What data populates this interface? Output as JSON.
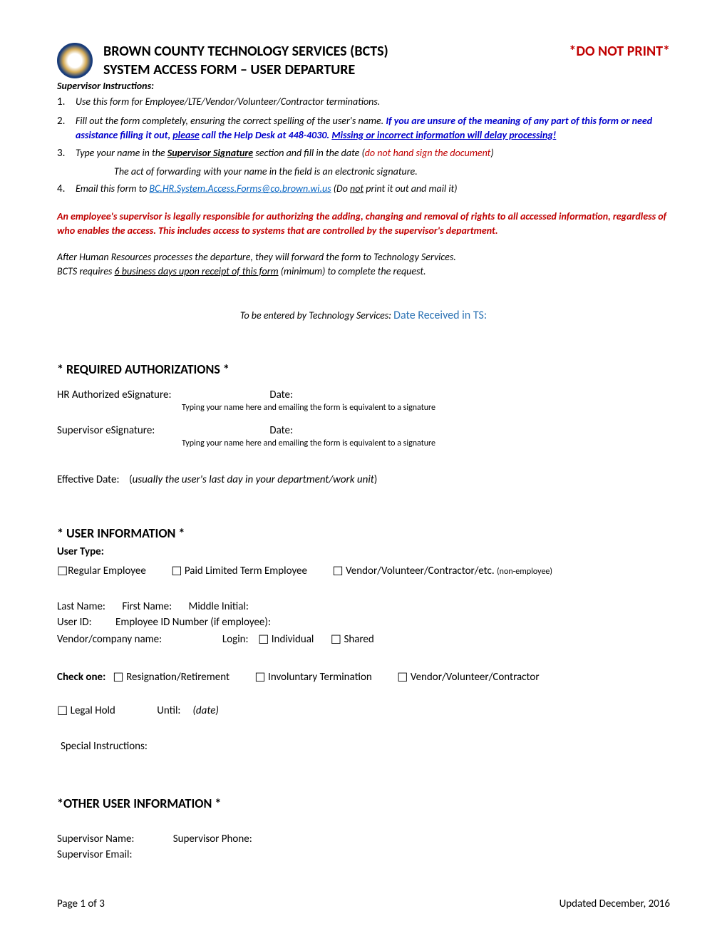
{
  "header": {
    "title": "BROWN COUNTY TECHNOLOGY SERVICES (BCTS)",
    "do_not_print": "*DO NOT PRINT*",
    "subtitle": "SYSTEM ACCESS FORM – USER DEPARTURE",
    "supervisor_instructions_label": "Supervisor Instructions:"
  },
  "instructions": {
    "n1": "1.",
    "t1": "Use this form for Employee/LTE/Vendor/Volunteer/Contractor terminations.",
    "n2": "2.",
    "t2a": "Fill out the form completely, ensuring the correct spelling of the user's name.  ",
    "t2b": "If you are unsure of the meaning of any part of this form or need assistance filling it out, ",
    "t2b_please": "please",
    "t2c": " call the Help Desk at 448-4030.  ",
    "t2d": "Missing or incorrect information will delay processing!",
    "n3": "3.",
    "t3a": "Type your name in the ",
    "t3b": "Supervisor Signature",
    "t3c": " section and fill in the date (",
    "t3d": "do not hand sign the document",
    "t3e": ")",
    "t3_sub": "The act of forwarding with your name in the field is an electronic signature.",
    "n4": "4.",
    "t4a": "Email this form to ",
    "t4b": "BC.HR.System.Access.Forms@co.brown.wi.us",
    "t4c": "     (Do ",
    "t4d": "not",
    "t4e": " print it out and mail it)"
  },
  "legal": {
    "text": "An employee's supervisor is legally responsible for authorizing the adding, changing and removal of rights to all accessed information, regardless of who enables the access.  This includes access to systems that are controlled by the supervisor's department."
  },
  "after_hr": {
    "line1": "After Human Resources processes the departure, they will forward the form to Technology Services.",
    "line2a": "BCTS requires ",
    "line2b": "6 business days upon receipt of this form",
    "line2c": " (minimum) to complete the request."
  },
  "ts": {
    "label": "To be entered by Technology Services:  ",
    "field": "Date Received in TS:"
  },
  "sections": {
    "required_auth": "* REQUIRED AUTHORIZATIONS *",
    "user_info": "* USER INFORMATION *",
    "other_user_info": "*OTHER USER INFORMATION *"
  },
  "auth": {
    "hr_label": "HR Authorized eSignature:",
    "date_label": "Date:",
    "sub_text": "Typing your name here and emailing the form is equivalent to a signature",
    "supervisor_label": "Supervisor eSignature:",
    "effective_label": "Effective Date:",
    "effective_note": "usually the user's last day in your department/work unit"
  },
  "user_type": {
    "heading": "User Type:",
    "opt1": "Regular Employee",
    "opt2": "Paid Limited Term Employee",
    "opt3": "Vendor/Volunteer/Contractor/etc. ",
    "opt3_small": "(non-employee)"
  },
  "fields": {
    "last_name": "Last Name:",
    "first_name": "First Name:",
    "middle_initial": "Middle Initial:",
    "user_id": "User ID:",
    "employee_id": "Employee ID Number (if employee):",
    "vendor_company": "Vendor/company name:",
    "login": "Login:",
    "individual": "Individual",
    "shared": "Shared"
  },
  "check_one": {
    "label": "Check one:",
    "opt1": "Resignation/Retirement",
    "opt2": "Involuntary Termination",
    "opt3": "Vendor/Volunteer/Contractor"
  },
  "legal_hold": {
    "label": "Legal Hold",
    "until": "Until:",
    "date": "(date)"
  },
  "special_instructions_label": "Special Instructions:",
  "supervisor": {
    "name": "Supervisor Name:",
    "phone": "Supervisor Phone:",
    "email": "Supervisor Email:"
  },
  "footer": {
    "page": "Page 1 of 3",
    "updated": "Updated December, 2016"
  }
}
